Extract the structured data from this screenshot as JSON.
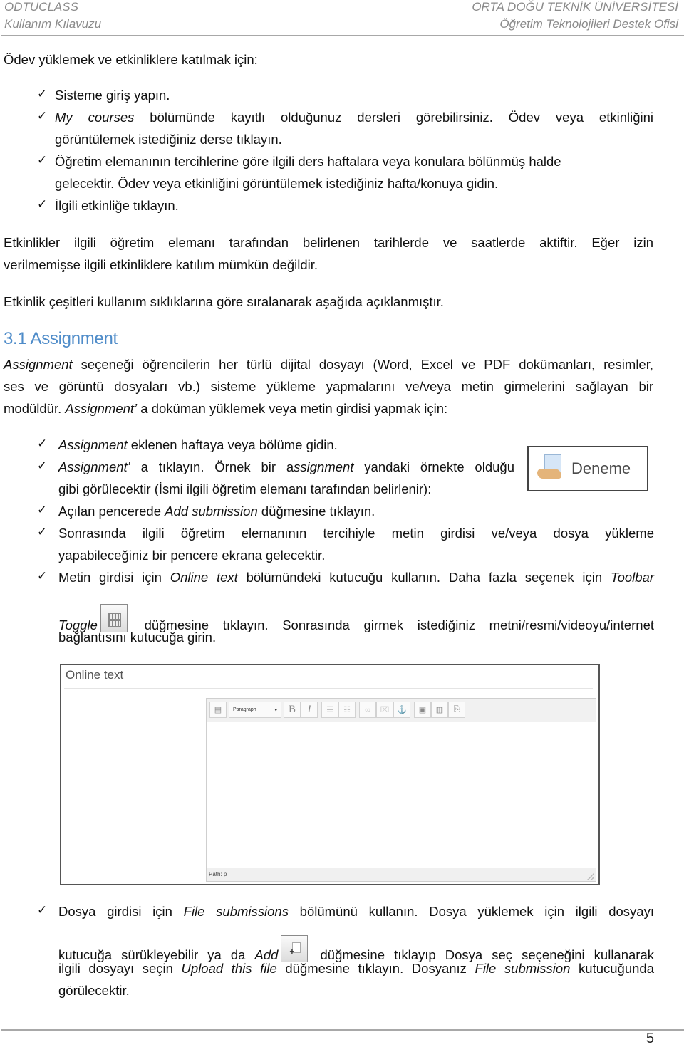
{
  "header": {
    "left_line1": "ODTUCLASS",
    "left_line2": "Kullanım Kılavuzu",
    "right_line1": "ORTA DOĞU TEKNİK ÜNİVERSİTESİ",
    "right_line2": "Öğretim Teknolojileri Destek Ofisi"
  },
  "intro": "Ödev yüklemek ve etkinliklere katılmak için:",
  "steps": [
    {
      "text": "Sisteme giriş yapın."
    },
    {
      "em": "My courses",
      "text": " bölümünde kayıtlı olduğunuz dersleri görebilirsiniz. Ödev veya etkinliğini",
      "text2": "görüntülemek istediğiniz derse tıklayın."
    },
    {
      "text": "Öğretim elemanının tercihlerine göre ilgili ders haftalara veya konulara bölünmüş halde",
      "text2": "gelecektir. Ödev veya etkinliğini görüntülemek istediğiniz hafta/konuya gidin."
    },
    {
      "text": "İlgili etkinliğe tıklayın."
    }
  ],
  "para_active": "Etkinlikler ilgili öğretim elemanı tarafından belirlenen tarihlerde ve saatlerde aktiftir. Eğer izin",
  "para_active2": "verilmemişse ilgili etkinliklere katılım mümkün değildir.",
  "para_types": "Etkinlik çeşitleri kullanım sıklıklarına göre sıralanarak aşağıda açıklanmıştır.",
  "section": {
    "heading": "3.1 Assignment",
    "desc_em": "Assignment",
    "desc_1": " seçeneği öğrencilerin her türlü dijital dosyayı (Word,  Excel ve PDF dokümanları, resimler,",
    "desc_2": "ses ve görüntü dosyaları vb.) sisteme yükleme yapmalarını ve/veya metin girmelerini sağlayan bir",
    "desc_3a": "modüldür. ",
    "desc_3em": "Assignment’",
    "desc_3b": " a doküman yüklemek veya metin girdisi yapmak için:"
  },
  "assignment_steps": {
    "s1_em": "Assignment",
    "s1": " eklenen haftaya veya bölüme gidin.",
    "s2_em": "Assignment’",
    "s2a": " a tıklayın. Örnek bir a",
    "s2_em2": "ssignment",
    "s2b": " yandaki örnekte olduğu",
    "s2c": "gibi görülecektir (İsmi ilgili öğretim elemanı tarafından belirlenir):",
    "s3a": "Açılan pencerede ",
    "s3_em": "Add submission",
    "s3b": " düğmesine tıklayın.",
    "s4": "Sonrasında ilgili öğretim elemanının tercihiyle metin girdisi ve/veya dosya yükleme",
    "s4b": "yapabileceğiniz bir pencere ekrana gelecektir.",
    "s5a": "Metin girdisi için ",
    "s5_em": "Online text",
    "s5b": " bölümündeki kutucuğu kullanın. Daha fazla seçenek için ",
    "s5_em2": "Toolbar",
    "s5_em3": "Toggle",
    "s5c": " düğmesine tıklayın. Sonrasında girmek istediğiniz metni/resmi/videoyu/internet",
    "s5d": "bağlantısını kutucuğa girin.",
    "s6a": "Dosya girdisi için ",
    "s6_em": "File submissions",
    "s6b": " bölümünü kullanın. Dosya yüklemek için ilgili dosyayı",
    "s6c": "kutucuğa sürükleyebilir ya da ",
    "s6_em2": "Add",
    "s6d": " düğmesine tıklayıp Dosya seç seçeneğini kullanarak",
    "s6e": "ilgili dosyayı seçin ",
    "s6_em3": "Upload this file",
    "s6f": " düğmesine tıklayın. Dosyanız ",
    "s6_em4": "File submission",
    "s6g": " kutucuğunda",
    "s6h": "görülecektir."
  },
  "deneme_example": {
    "label": "Deneme",
    "icon": "assignment-icon"
  },
  "editor_screenshot": {
    "section_title": "Online text",
    "format_select": "Paragraph",
    "toolbar_icons": [
      "toolbar-toggle-icon",
      "bold-icon",
      "italic-icon",
      "unordered-list-icon",
      "ordered-list-icon",
      "link-icon",
      "unlink-icon",
      "anchor-icon",
      "image-icon",
      "media-icon",
      "file-manager-icon"
    ],
    "bold_glyph": "B",
    "italic_glyph": "I",
    "path_label": "Path: p"
  },
  "check_glyph": "✓",
  "page_number": "5"
}
